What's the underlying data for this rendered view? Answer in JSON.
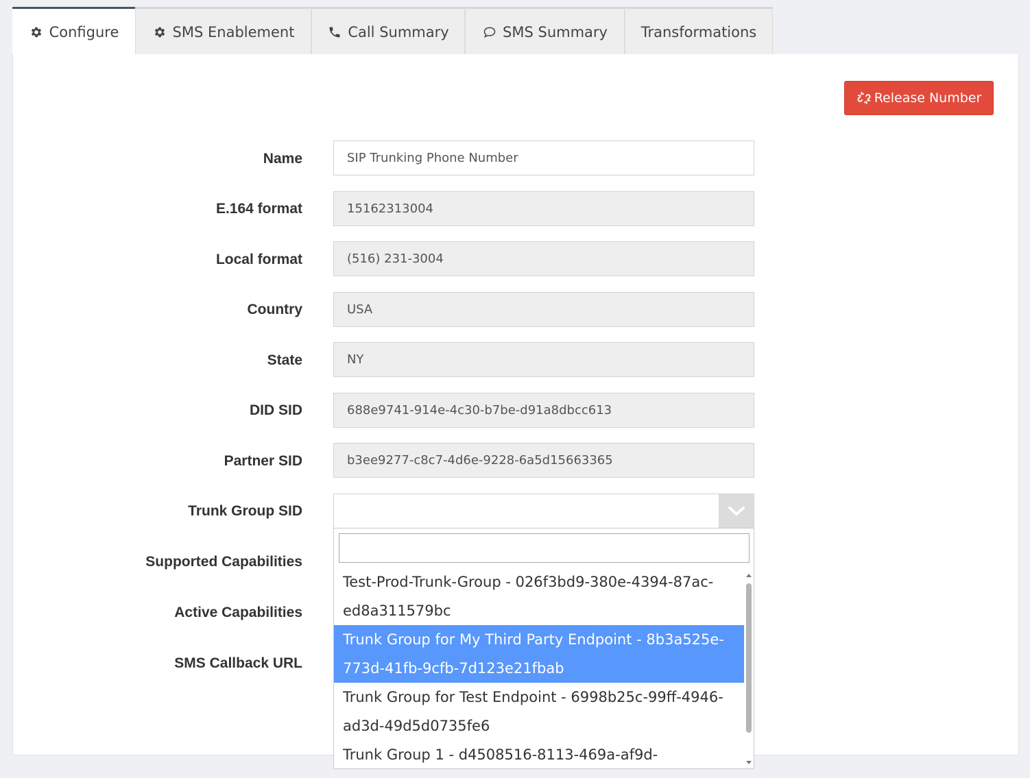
{
  "tabs": [
    {
      "label": "Configure",
      "icon": "gear-icon",
      "active": true
    },
    {
      "label": "SMS Enablement",
      "icon": "gear-icon",
      "active": false
    },
    {
      "label": "Call Summary",
      "icon": "phone-icon",
      "active": false
    },
    {
      "label": "SMS Summary",
      "icon": "chat-bubble-icon",
      "active": false
    },
    {
      "label": "Transformations",
      "icon": "",
      "active": false
    }
  ],
  "release_button": {
    "label": "Release Number",
    "icon": "unlink-icon",
    "color": "#e24b3b"
  },
  "form": {
    "name": {
      "label": "Name",
      "value": "SIP Trunking Phone Number"
    },
    "e164": {
      "label": "E.164 format",
      "value": "15162313004"
    },
    "local": {
      "label": "Local format",
      "value": "(516) 231-3004"
    },
    "country": {
      "label": "Country",
      "value": "USA"
    },
    "state": {
      "label": "State",
      "value": "NY"
    },
    "did_sid": {
      "label": "DID SID",
      "value": "688e9741-914e-4c30-b7be-d91a8dbcc613"
    },
    "partner_sid": {
      "label": "Partner SID",
      "value": "b3ee9277-c8c7-4d6e-9228-6a5d15663365"
    },
    "trunk_group_sid": {
      "label": "Trunk Group SID",
      "value": ""
    },
    "supported_capabilities": {
      "label": "Supported Capabilities"
    },
    "active_capabilities": {
      "label": "Active Capabilities"
    },
    "sms_callback_url": {
      "label": "SMS Callback URL"
    }
  },
  "dropdown": {
    "search_value": "",
    "options": [
      {
        "line1": "Test-Prod-Trunk-Group - 026f3bd9-380e-4394-87ac-",
        "line2": "ed8a311579bc",
        "selected": false
      },
      {
        "line1": "Trunk Group for My Third Party Endpoint - 8b3a525e-",
        "line2": "773d-41fb-9cfb-7d123e21fbab",
        "selected": true
      },
      {
        "line1": "Trunk Group for Test Endpoint - 6998b25c-99ff-4946-",
        "line2": "ad3d-49d5d0735fe6",
        "selected": false
      },
      {
        "line1": "Trunk Group 1 - d4508516-8113-469a-af9d-",
        "line2": "",
        "selected": false
      }
    ],
    "highlight_color": "#5897fb"
  }
}
